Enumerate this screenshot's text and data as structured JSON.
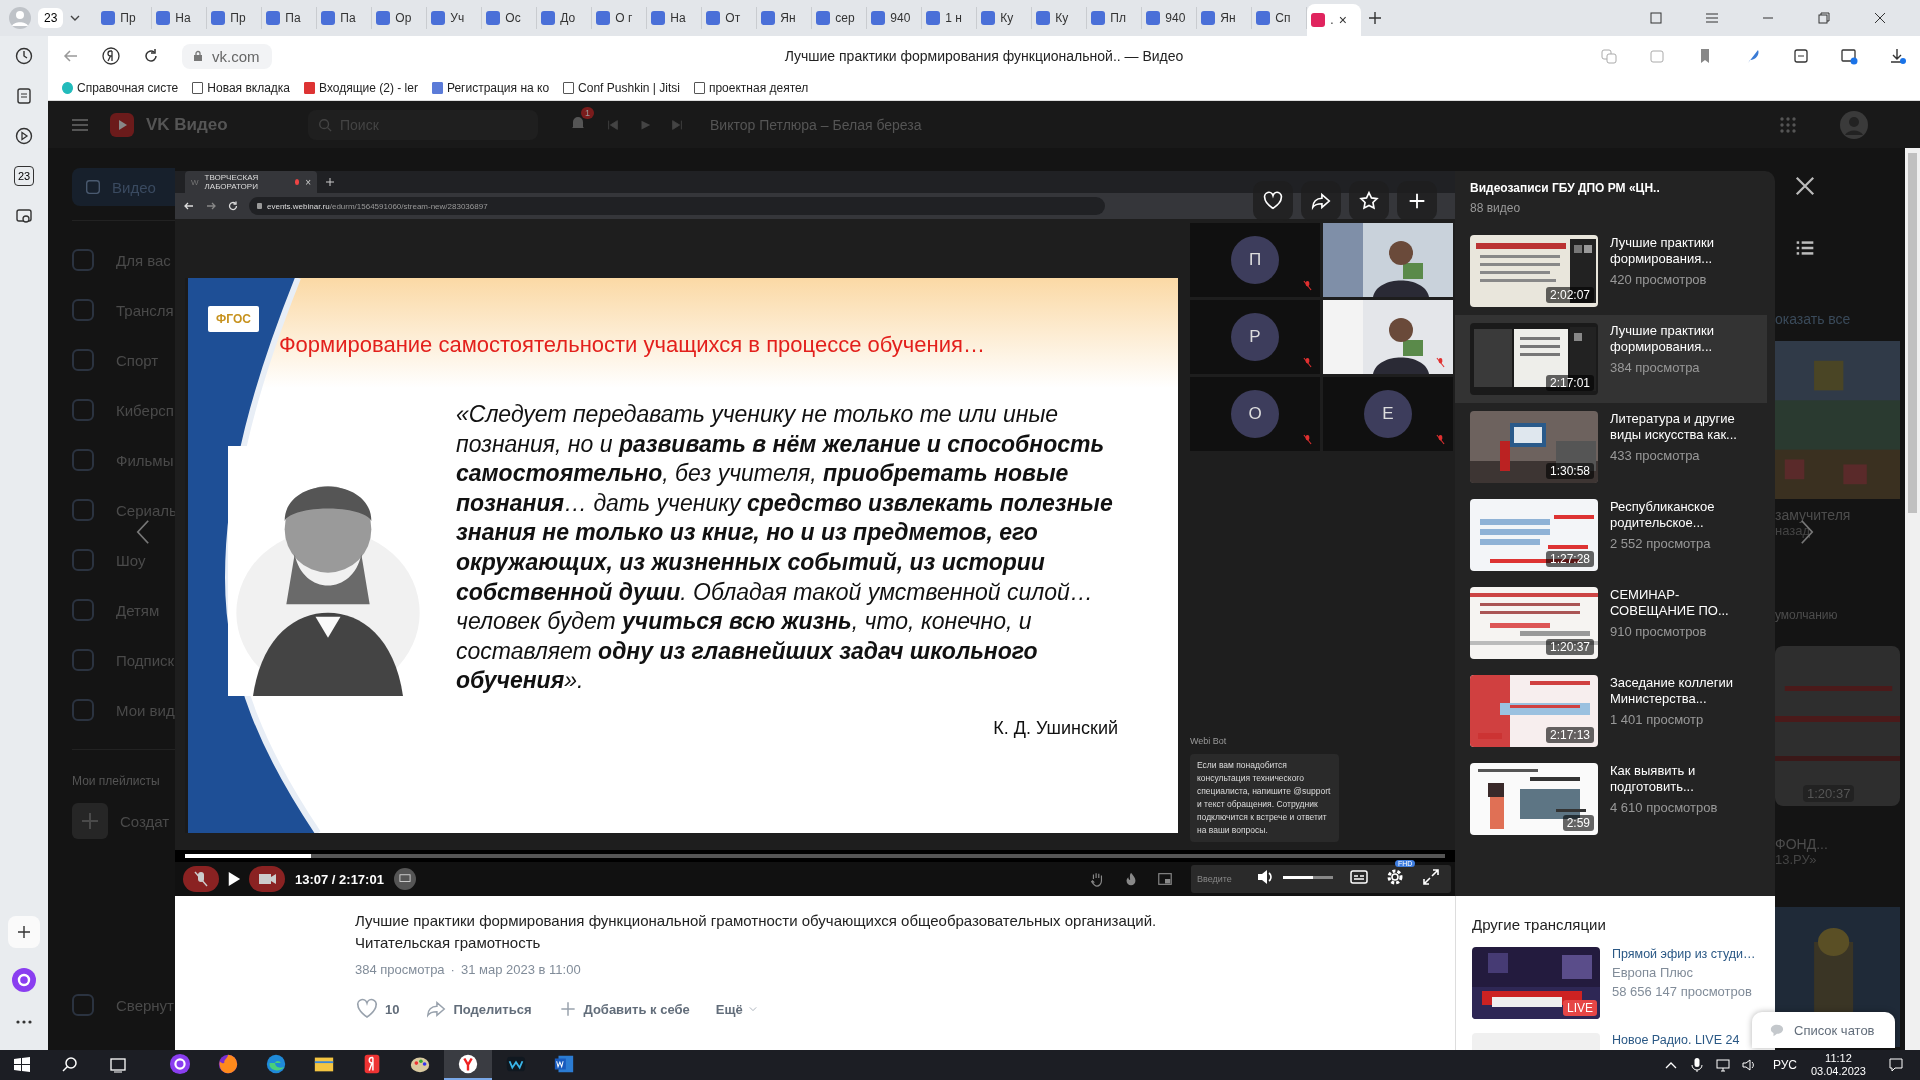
{
  "browser": {
    "tab_count": "23",
    "tabs": [
      {
        "label": "Пр",
        "selected": false
      },
      {
        "label": "На",
        "selected": false
      },
      {
        "label": "Пр",
        "selected": false
      },
      {
        "label": "Па",
        "selected": false
      },
      {
        "label": "Па",
        "selected": false
      },
      {
        "label": "Ор",
        "selected": false
      },
      {
        "label": "Уч",
        "selected": false
      },
      {
        "label": "Ос",
        "selected": false
      },
      {
        "label": "До",
        "selected": false
      },
      {
        "label": "О г",
        "selected": false
      },
      {
        "label": "На",
        "selected": false
      },
      {
        "label": "От",
        "selected": false
      },
      {
        "label": "Ян",
        "selected": false
      },
      {
        "label": "сер",
        "selected": false
      },
      {
        "label": "940",
        "selected": false
      },
      {
        "label": "1 н",
        "selected": false
      },
      {
        "label": "Ку",
        "selected": false
      },
      {
        "label": "Ку",
        "selected": false
      },
      {
        "label": "Пл",
        "selected": false
      },
      {
        "label": "940",
        "selected": false
      },
      {
        "label": "Ян",
        "selected": false
      },
      {
        "label": "Сп",
        "selected": false
      },
      {
        "label": ".",
        "selected": true
      }
    ],
    "address": "vk.com",
    "page_title": "Лучшие практики формирования функциональной.. — Видео",
    "bookmarks": [
      "Справочная систе",
      "Новая вкладка",
      "Входящие (2) - ler",
      "Регистрация на ко",
      "Conf Pushkin | Jitsi",
      "проектная деятел"
    ],
    "sidebar_calendar": "23",
    "tab_close": "×"
  },
  "vk_header": {
    "logo": "VK Видео",
    "search": {
      "placeholder": "Поиск"
    },
    "notifications": "1",
    "now_playing": "Виктор Петлюра – Белая береза"
  },
  "nav": {
    "main_button": "Видео",
    "items": [
      "Для вас",
      "Трансля",
      "Спорт",
      "Киберсп",
      "Фильмы",
      "Сериаль",
      "Шоу",
      "Детям",
      "Подписк",
      "Мои вид"
    ],
    "playlists_heading": "Мои плейлисты",
    "create": "Создат",
    "collapse": "Свернут"
  },
  "background_fragments": {
    "show_all": "оказать все",
    "title_1": "замучителя",
    "time_1": "назад",
    "sort": "умолчанию",
    "duration": "1:20:37",
    "title_2": "ФОНД...",
    "channel_2": "13.РУ»"
  },
  "recording": {
    "tab_icon": "W",
    "tab_title": "ТВОРЧЕСКАЯ ЛАБОРАТОРИ",
    "tab_close": "×",
    "url_host": "events.webinar.ru",
    "url_path": "/edurm/1564591060/stream-new/283036897",
    "slide": {
      "badge": "ФГОС",
      "title": "Формирование самостоятельности учащихся в процессе обучения…",
      "quote": "«Следует передавать ученику не только те или иные познания, но и **развивать в нём желание и способность самостоятельно**, без учителя, **приобретать новые познания**… дать ученику **средство извлекать полезные знания не только из книг, но и из предметов, его окружающих, из жизненных событий, из истории собственной души**. Обладая такой умственной силой… человек будет **учиться всю жизнь**, что, конечно, и составляет **одну из главнейших задач школьного обучения**».",
      "author": "К. Д. Ушинский"
    },
    "participants": [
      {
        "kind": "avatar",
        "initial": "П",
        "muted": true
      },
      {
        "kind": "camera",
        "muted": false
      },
      {
        "kind": "avatar",
        "initial": "Р",
        "muted": true
      },
      {
        "kind": "camera",
        "muted": true
      },
      {
        "kind": "avatar",
        "initial": "О",
        "muted": true
      },
      {
        "kind": "avatar",
        "initial": "Е",
        "muted": true
      }
    ],
    "chat": {
      "sender": "Webi Bot",
      "message": "Если вам понадобится консультация технического специалиста, напишите @support и текст обращения. Сотрудник подключится к встрече и ответит на ваши вопросы.",
      "input_placeholder": "Введите"
    },
    "time": "13:07 / 2:17:01",
    "progress": {
      "level": 0.1
    }
  },
  "player": {
    "volume": {
      "level": 0.6
    },
    "quality_badge": "FHD"
  },
  "playlist": {
    "title": "Видеозаписи ГБУ ДПО РМ «ЦН..",
    "count": "88 видео",
    "items": [
      {
        "title": "Лучшие практики формирования...",
        "views": "420 просмотров",
        "duration": "2:02:07",
        "selected": false
      },
      {
        "title": "Лучшие практики формирования...",
        "views": "384 просмотра",
        "duration": "2:17:01",
        "selected": true
      },
      {
        "title": "Литература и другие виды искусства как...",
        "views": "433 просмотра",
        "duration": "1:30:58",
        "selected": false
      },
      {
        "title": "Республиканское родительское...",
        "views": "2 552 просмотра",
        "duration": "1:27:28",
        "selected": false
      },
      {
        "title": "СЕМИНАР-СОВЕЩАНИЕ ПО...",
        "views": "910 просмотров",
        "duration": "1:20:37",
        "selected": false
      },
      {
        "title": "Заседание коллегии Министерства...",
        "views": "1 401 просмотр",
        "duration": "2:17:13",
        "selected": false
      },
      {
        "title": "Как выявить и подготовить...",
        "views": "4 610 просмотров",
        "duration": "2:59",
        "selected": false
      }
    ]
  },
  "video_info": {
    "title": "Лучшие практики формирования функциональной грамотности обучающихся общеобразовательных организаций. Читательская грамотность",
    "views": "384 просмотра",
    "separator": "·",
    "date": "31 мар 2023 в 11:00",
    "likes": "10",
    "share": "Поделиться",
    "add": "Добавить к себе",
    "more": "Ещё"
  },
  "other_streams": {
    "heading": "Другие трансляции",
    "items": [
      {
        "title": "Прямой эфир из студи…",
        "channel": "Европа Плюс",
        "views": "58 656 147 просмотров",
        "badge": "LIVE"
      },
      {
        "title": "Новое Радио. LIVE 24"
      }
    ]
  },
  "chat_list_button": "Список чатов",
  "taskbar": {
    "apps": [
      {
        "kind": "alice",
        "selected": false
      },
      {
        "kind": "firefox",
        "selected": false
      },
      {
        "kind": "edge",
        "selected": false
      },
      {
        "kind": "explorer",
        "selected": false
      },
      {
        "kind": "yandex-market",
        "selected": false
      },
      {
        "kind": "paint",
        "selected": false
      },
      {
        "kind": "yandex",
        "selected": true
      },
      {
        "kind": "webinar",
        "selected": false
      },
      {
        "kind": "word",
        "selected": false
      }
    ],
    "language": "РУС",
    "time": "11:12",
    "date": "03.04.2023"
  }
}
